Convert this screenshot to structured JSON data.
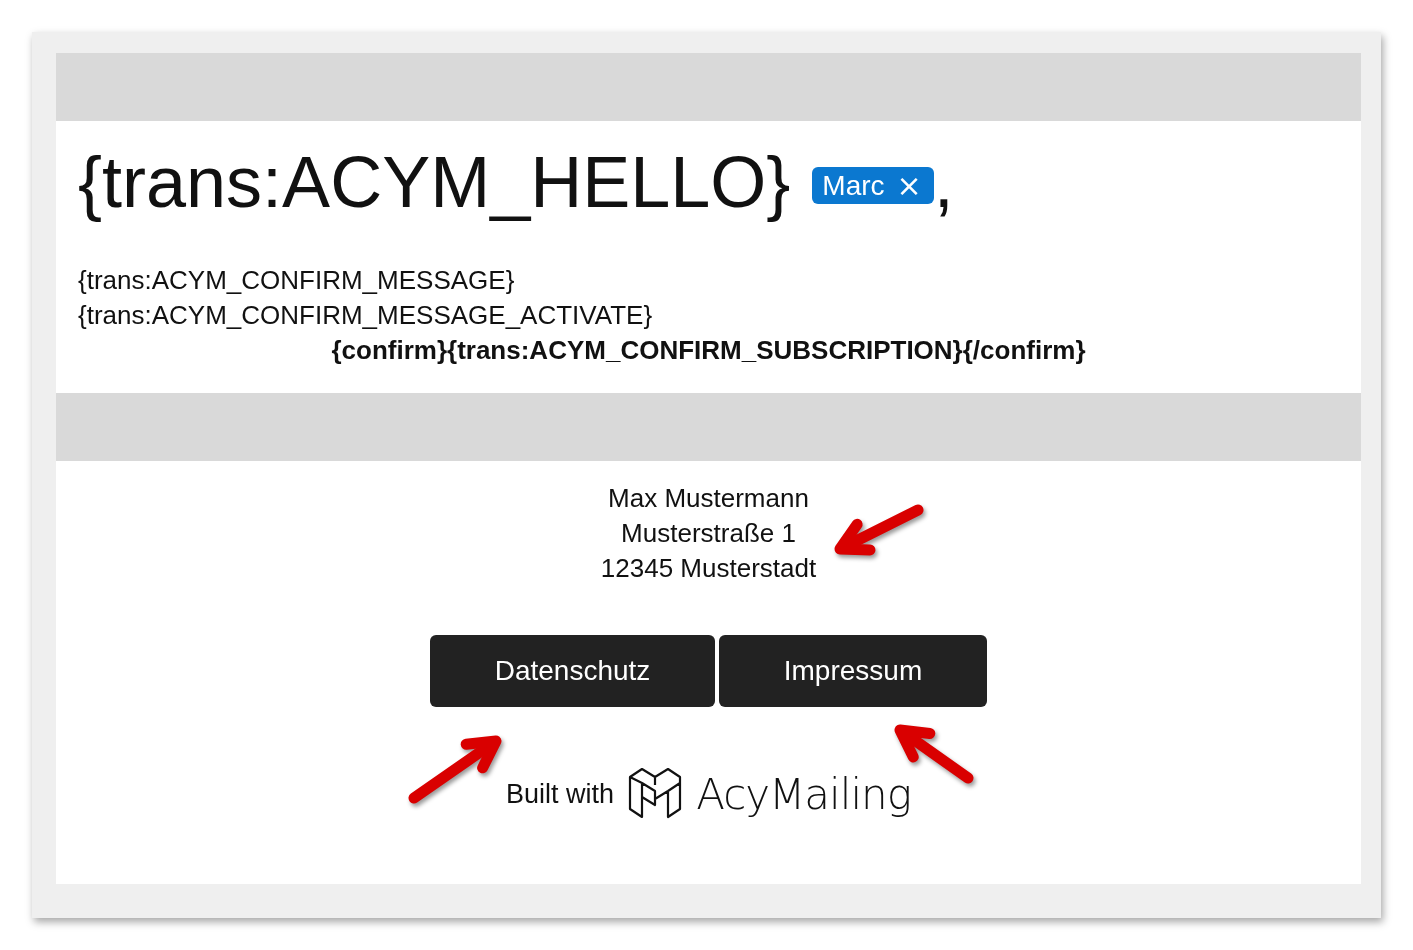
{
  "greeting": {
    "text": "{trans:ACYM_HELLO}",
    "tag": {
      "label": "Marc",
      "remove": "×"
    },
    "suffix": ","
  },
  "message_lines": [
    "{trans:ACYM_CONFIRM_MESSAGE}",
    "{trans:ACYM_CONFIRM_MESSAGE_ACTIVATE}"
  ],
  "confirm_link": "{confirm}{trans:ACYM_CONFIRM_SUBSCRIPTION}{/confirm}",
  "address": [
    "Max Mustermann",
    "Musterstraße 1",
    "12345 Musterstadt"
  ],
  "buttons": [
    "Datenschutz",
    "Impressum"
  ],
  "footer": {
    "built_with": "Built with",
    "brand": "AcyMailing"
  }
}
